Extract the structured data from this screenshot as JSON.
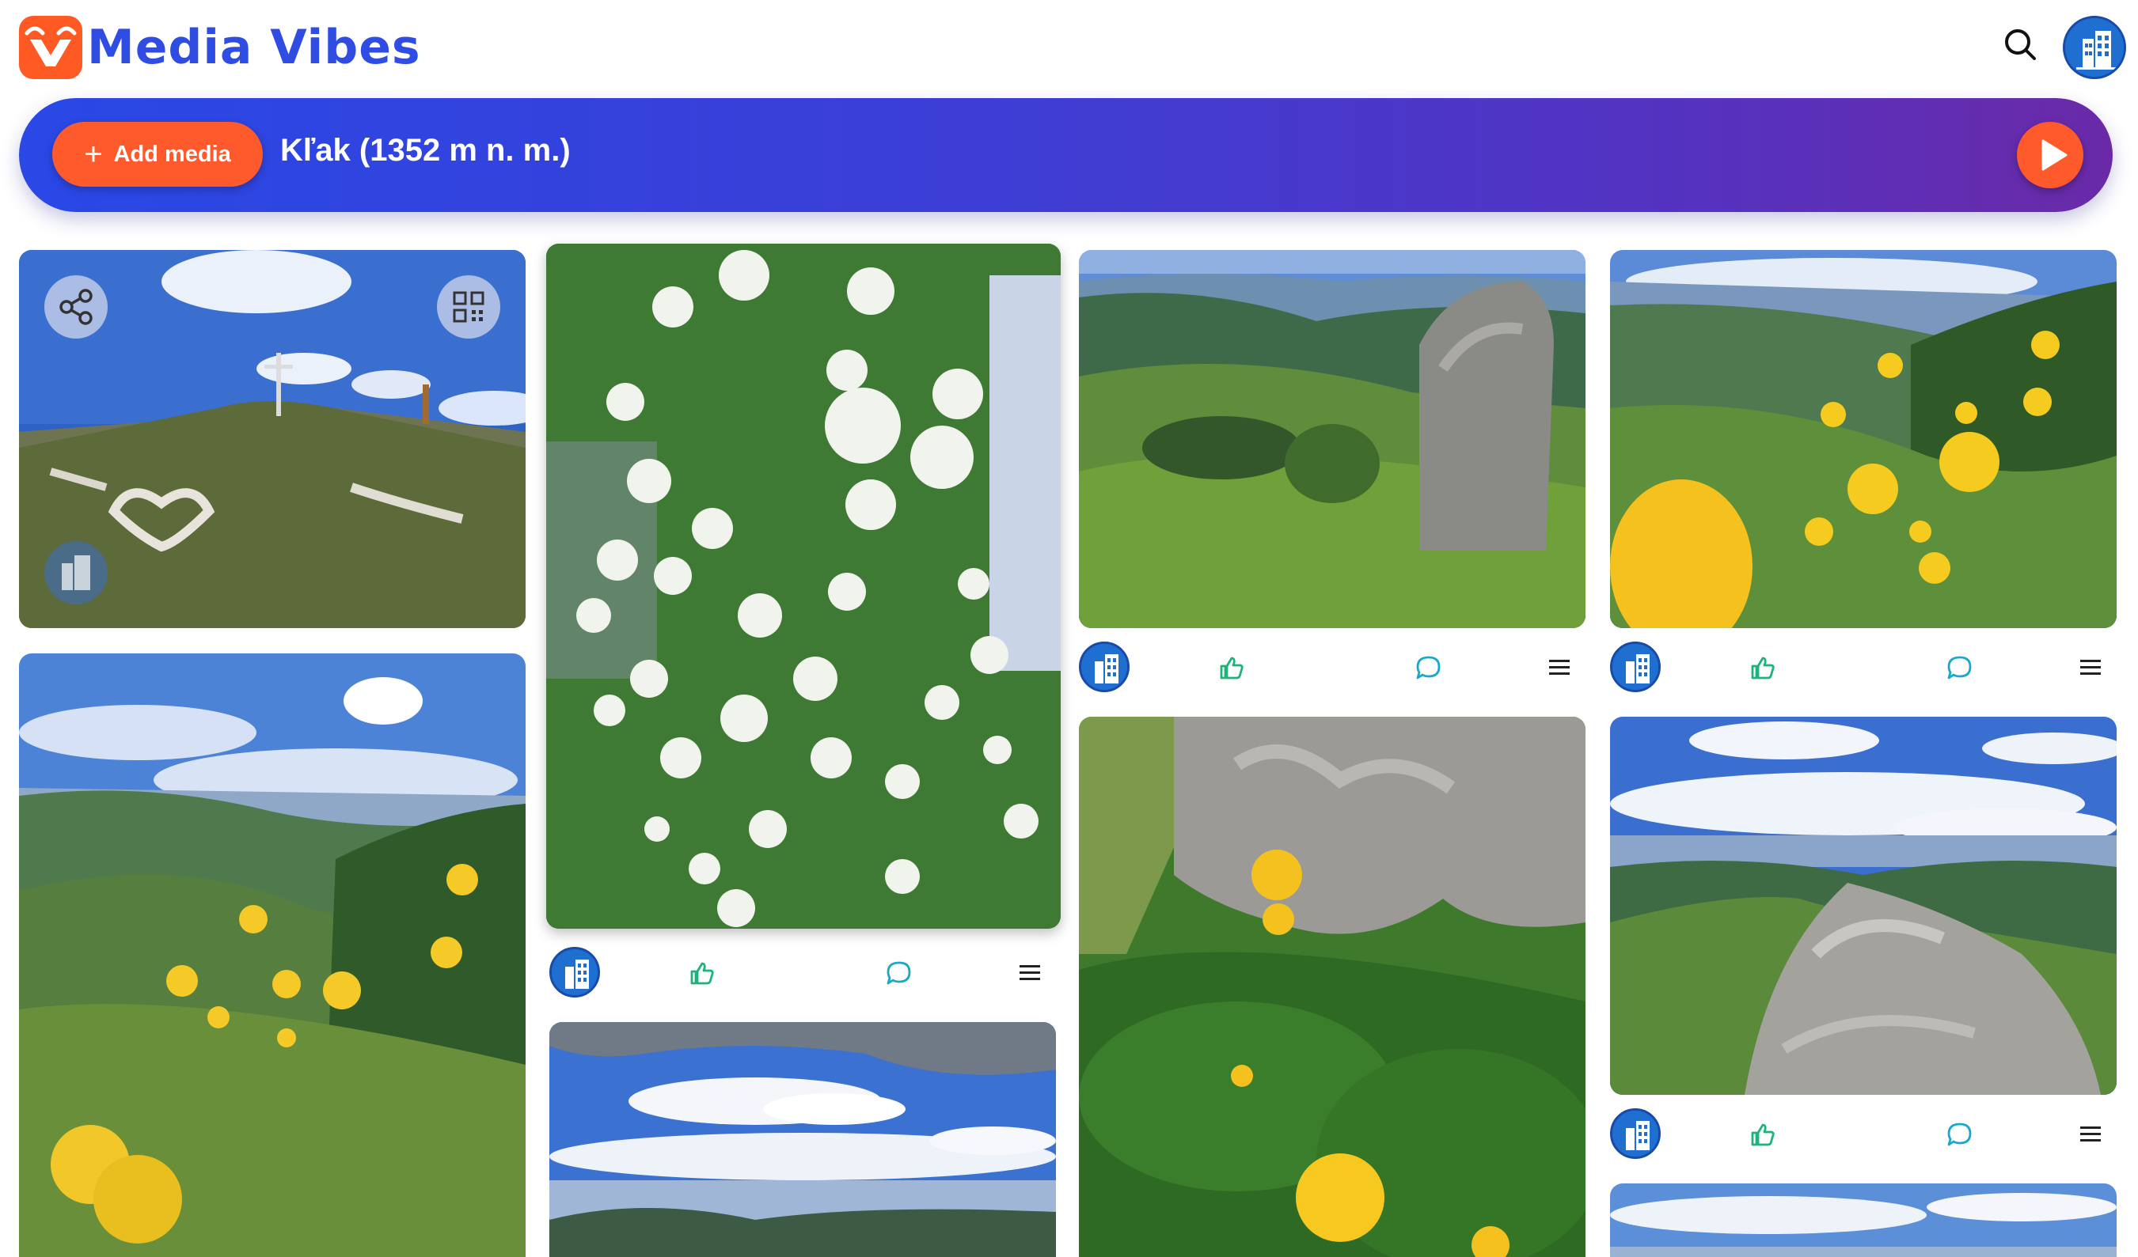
{
  "app": {
    "name": "Media Vibes",
    "logo_icon": "mv-logo-icon",
    "brand_color": "#2f4de3",
    "accent_color": "#ff5a2c"
  },
  "header": {
    "search_icon": "search-icon",
    "avatar_icon": "building-avatar-icon"
  },
  "banner": {
    "add_label": "Add media",
    "title": "Kľak (1352 m n. m.)",
    "play_icon": "play-icon"
  },
  "feed": {
    "like_icon": "thumbs-up-icon",
    "comment_icon": "comment-icon",
    "menu_icon": "menu-icon",
    "overlay_icons": [
      "share-icon",
      "qr-code-icon"
    ],
    "photos": [
      "summit with cross and stone heart",
      "white snowball viburnum flowers",
      "valley view with rock outcrop",
      "yellow globeflowers on slope",
      "valley with yellow globeflowers",
      "yellow globeflowers by rocks",
      "rocky ridge with clouds",
      "mountain ridge panorama",
      "cloudy horizon"
    ]
  }
}
